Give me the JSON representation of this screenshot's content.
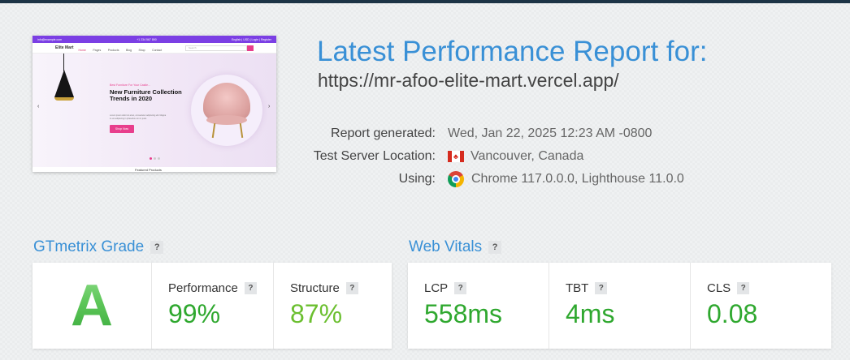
{
  "thumbnail": {
    "topbar_email": "info@example.com",
    "topbar_phone": "+1 234 567 890",
    "topbar_links": "English | USD | Login | Register",
    "logo": "Elite Mart",
    "menu": [
      "Home",
      "Pages",
      "Products",
      "Blog",
      "Shop",
      "Contact"
    ],
    "search_placeholder": "Search",
    "hero_small": "Best Furniture For Your Castle...",
    "hero_title": "New Furniture Collection Trends in 2020",
    "hero_desc": "Lorem ipsum dolor sit amet, consectetur adipiscing elit. Magna in est adipiscing in phasellus non in justo.",
    "hero_button": "Shop Now",
    "bottom_text": "Featured Products"
  },
  "report": {
    "title": "Latest Performance Report for:",
    "url": "https://mr-afoo-elite-mart.vercel.app/",
    "generated_label": "Report generated:",
    "generated_value": "Wed, Jan 22, 2025 12:23 AM -0800",
    "location_label": "Test Server Location:",
    "location_value": "Vancouver, Canada",
    "using_label": "Using:",
    "using_value": "Chrome 117.0.0.0, Lighthouse 11.0.0"
  },
  "grade_section": {
    "title": "GTmetrix Grade",
    "help": "?",
    "grade": "A",
    "grade_color": "#3fb03f",
    "metrics": [
      {
        "label": "Performance",
        "value": "99%",
        "color": "#2fa82f"
      },
      {
        "label": "Structure",
        "value": "87%",
        "color": "#6bbf2f"
      }
    ]
  },
  "vitals_section": {
    "title": "Web Vitals",
    "help": "?",
    "metrics": [
      {
        "label": "LCP",
        "value": "558ms",
        "color": "#2fa82f"
      },
      {
        "label": "TBT",
        "value": "4ms",
        "color": "#2fa82f"
      },
      {
        "label": "CLS",
        "value": "0.08",
        "color": "#2fa82f"
      }
    ]
  },
  "colors": {
    "accent_blue": "#3990d6",
    "top_bar": "#1d3446"
  }
}
